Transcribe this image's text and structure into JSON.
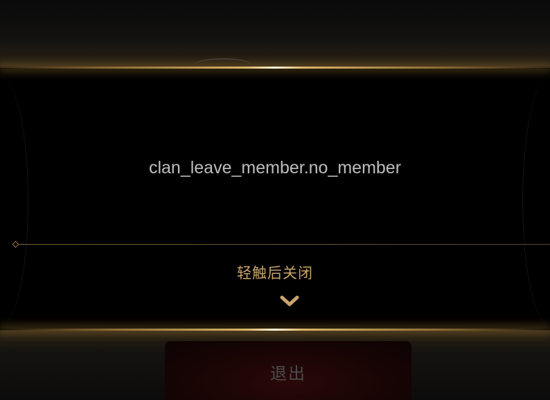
{
  "popup": {
    "message": "clan_leave_member.no_member",
    "tap_hint": "轻触后关闭",
    "hint_icon": "chevron-down-icon"
  },
  "background": {
    "exit_button_label": "退出"
  },
  "colors": {
    "gold_accent": "#d9b56a",
    "hint_text": "#c9a46b",
    "message_text": "#bdbdbd",
    "exit_button_bg": "#1a0505"
  }
}
